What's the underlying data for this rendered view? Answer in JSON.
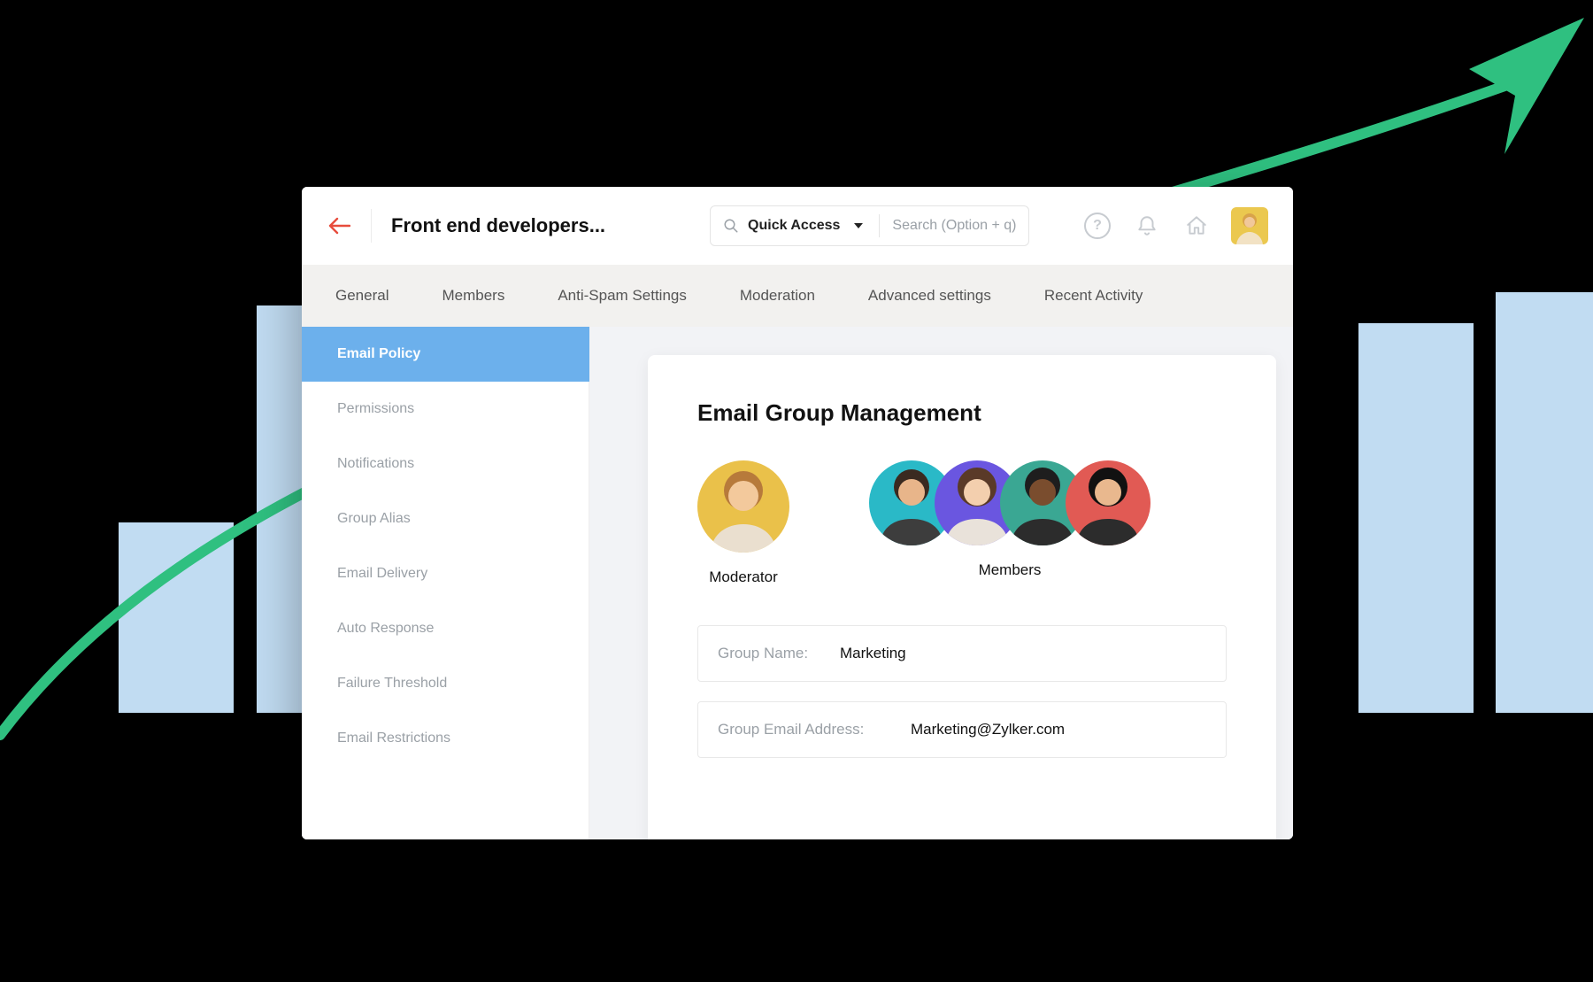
{
  "header": {
    "page_title": "Front end developers...",
    "quick_access_label": "Quick Access",
    "search_placeholder": "Search (Option + q)"
  },
  "tabs": [
    {
      "label": "General"
    },
    {
      "label": "Members"
    },
    {
      "label": "Anti-Spam Settings"
    },
    {
      "label": "Moderation"
    },
    {
      "label": "Advanced settings"
    },
    {
      "label": "Recent Activity"
    }
  ],
  "sidebar": {
    "items": [
      {
        "label": "Email Policy",
        "active": true
      },
      {
        "label": "Permissions"
      },
      {
        "label": "Notifications"
      },
      {
        "label": "Group Alias"
      },
      {
        "label": "Email Delivery"
      },
      {
        "label": "Auto Response"
      },
      {
        "label": "Failure Threshold"
      },
      {
        "label": "Email Restrictions"
      }
    ]
  },
  "card": {
    "title": "Email Group Management",
    "moderator_label": "Moderator",
    "members_label": "Members",
    "group_name_label": "Group Name:",
    "group_name_value": "Marketing",
    "group_email_label": "Group Email Address:",
    "group_email_value": "Marketing@Zylker.com"
  },
  "avatars": {
    "moderator_bg": "#eac14a",
    "members": [
      {
        "bg": "#2ab9c7"
      },
      {
        "bg": "#6a56e0"
      },
      {
        "bg": "#3aa793"
      },
      {
        "bg": "#e15a54"
      }
    ]
  },
  "colors": {
    "sidebar_active": "#6cb0ec",
    "accent_arrow": "#2fc080",
    "bar_fill": "#c1dcf2"
  }
}
